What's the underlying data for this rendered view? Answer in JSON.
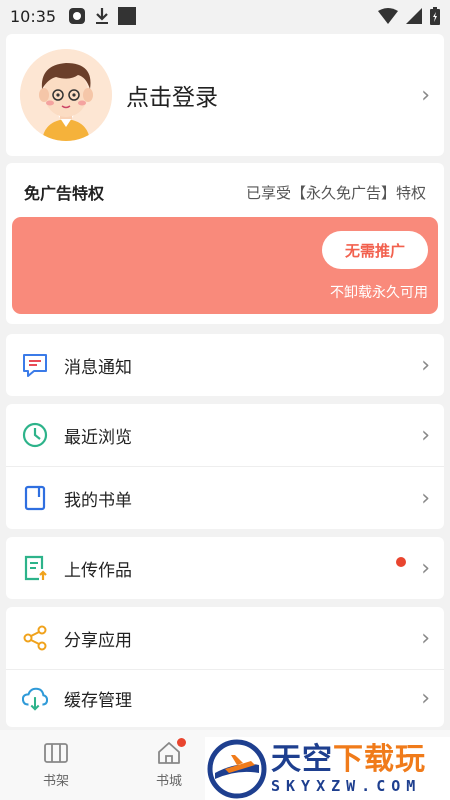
{
  "status_bar": {
    "time": "10:35"
  },
  "profile": {
    "login_text": "点击登录"
  },
  "privilege": {
    "title": "免广告特权",
    "status": "已享受【永久免广告】特权",
    "button": "无需推广",
    "subtitle": "不卸载永久可用",
    "banner_color": "#f98a7b"
  },
  "menu": {
    "notifications": "消息通知",
    "recent": "最近浏览",
    "booklist": "我的书单",
    "upload": "上传作品",
    "share": "分享应用",
    "cache": "缓存管理"
  },
  "bottom_nav": {
    "bookshelf": "书架",
    "bookstore": "书城"
  },
  "watermark": {
    "text_blue": "天空",
    "text_orange": "下载玩",
    "domain": "SKYXZW.COM"
  }
}
